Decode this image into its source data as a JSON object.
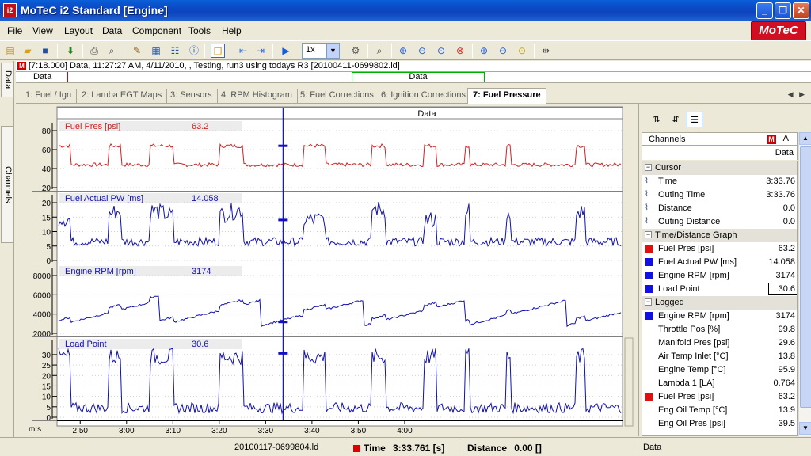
{
  "window": {
    "title": "MoTeC i2 Standard [Engine]",
    "app_icon": "i2",
    "logo": "MoTeC",
    "min": "_",
    "max": "❐",
    "close": "✕"
  },
  "menu": [
    "File",
    "View",
    "Layout",
    "Data",
    "Component",
    "Tools",
    "Help"
  ],
  "toolbar": {
    "zoom_value": "1x"
  },
  "info_line": {
    "badge": "M",
    "text": "[7:18.000] Data, 11:27:27 AM, 4/11/2010, , Testing, run3 using todays R3 [20100411-0699802.ld]"
  },
  "data_line": {
    "left_label": "Data",
    "range_label": "Data"
  },
  "left_dock": {
    "tabs": [
      "Data",
      "Channels"
    ]
  },
  "worksheet_tabs": [
    "1: Fuel / Ign",
    "2: Lamba EGT Maps",
    "3: Sensors",
    "4: RPM Histogram",
    "5: Fuel Corrections",
    "6: Ignition Corrections",
    "7: Fuel Pressure"
  ],
  "active_tab_index": 6,
  "graph": {
    "header": "Data",
    "x_axis_unit": "m:s",
    "x_ticks": [
      "2:50",
      "3:00",
      "3:10",
      "3:20",
      "3:30",
      "3:40",
      "3:50",
      "4:00"
    ],
    "cursor_time": "3:33.761",
    "panes": [
      {
        "label": "Fuel Pres [psi]",
        "value": "63.2",
        "color": "#d02020",
        "y_ticks": [
          "80",
          "60",
          "40",
          "20"
        ],
        "range": [
          20,
          80
        ]
      },
      {
        "label": "Fuel Actual PW [ms]",
        "value": "14.058",
        "color": "#1010b0",
        "y_ticks": [
          "20",
          "15",
          "10",
          "5",
          "0"
        ],
        "range": [
          0,
          20
        ]
      },
      {
        "label": "Engine RPM [rpm]",
        "value": "3174",
        "color": "#1010b0",
        "y_ticks": [
          "8000",
          "6000",
          "4000",
          "2000"
        ],
        "range": [
          2000,
          8000
        ]
      },
      {
        "label": "Load Point",
        "value": "30.6",
        "color": "#1010b0",
        "y_ticks": [
          "30",
          "25",
          "20",
          "15",
          "10",
          "5",
          "0"
        ],
        "range": [
          0,
          33
        ]
      }
    ]
  },
  "channels_panel": {
    "header": "Channels",
    "badge_m": "M",
    "badge_a": "A",
    "data_col": "Data",
    "groups": [
      {
        "name": "Cursor",
        "rows": [
          {
            "name": "Time",
            "value": "3:33.76",
            "marker": "icon"
          },
          {
            "name": "Outing Time",
            "value": "3:33.76",
            "marker": "icon"
          },
          {
            "name": "Distance",
            "value": "0.0",
            "marker": "icon"
          },
          {
            "name": "Outing Distance",
            "value": "0.0",
            "marker": "icon"
          }
        ]
      },
      {
        "name": "Time/Distance Graph",
        "rows": [
          {
            "name": "Fuel Pres [psi]",
            "value": "63.2",
            "marker": "#e01010"
          },
          {
            "name": "Fuel Actual PW [ms]",
            "value": "14.058",
            "marker": "#1010e0"
          },
          {
            "name": "Engine RPM [rpm]",
            "value": "3174",
            "marker": "#1010e0"
          },
          {
            "name": "Load Point",
            "value": "30.6",
            "marker": "#1010e0",
            "boxed": true
          }
        ]
      },
      {
        "name": "Logged",
        "rows": [
          {
            "name": "Engine RPM [rpm]",
            "value": "3174",
            "marker": "#1010e0"
          },
          {
            "name": "Throttle Pos [%]",
            "value": "99.8",
            "marker": ""
          },
          {
            "name": "Manifold Pres [psi]",
            "value": "29.6",
            "marker": ""
          },
          {
            "name": "Air Temp Inlet [°C]",
            "value": "13.8",
            "marker": ""
          },
          {
            "name": "Engine Temp [°C]",
            "value": "95.9",
            "marker": ""
          },
          {
            "name": "Lambda 1 [LA]",
            "value": "0.764",
            "marker": ""
          },
          {
            "name": "Fuel Pres [psi]",
            "value": "63.2",
            "marker": "#e01010"
          },
          {
            "name": "Eng Oil Temp [°C]",
            "value": "13.9",
            "marker": ""
          },
          {
            "name": "Eng Oil Pres [psi]",
            "value": "39.5",
            "marker": ""
          }
        ]
      }
    ]
  },
  "status_bar": {
    "file": "20100117-0699804.ld",
    "time_label": "Time",
    "time_value": "3:33.761 [s]",
    "distance_label": "Distance",
    "distance_value": "0.00 []",
    "right": "Data"
  }
}
